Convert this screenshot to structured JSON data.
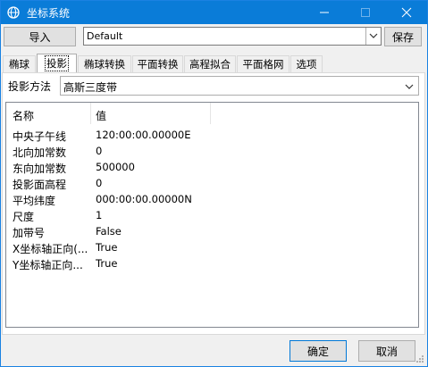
{
  "window": {
    "title": "坐标系统",
    "minimize_icon": "minimize-icon",
    "maximize_icon": "maximize-icon",
    "close_icon": "close-icon",
    "title_bar_color": "#0a7cd8"
  },
  "toolbar": {
    "import_label": "导入",
    "profile_value": "Default",
    "save_label": "保存"
  },
  "tabs": [
    {
      "label": "椭球",
      "active": false
    },
    {
      "label": "投影",
      "active": true
    },
    {
      "label": "椭球转换",
      "active": false
    },
    {
      "label": "平面转换",
      "active": false
    },
    {
      "label": "高程拟合",
      "active": false
    },
    {
      "label": "平面格网",
      "active": false
    },
    {
      "label": "选项",
      "active": false
    }
  ],
  "projection": {
    "method_label": "投影方法",
    "method_value": "高斯三度带"
  },
  "grid": {
    "headers": {
      "name": "名称",
      "value": "值"
    },
    "rows": [
      {
        "name": "中央子午线",
        "value": "120:00:00.00000E"
      },
      {
        "name": "北向加常数",
        "value": "0"
      },
      {
        "name": "东向加常数",
        "value": "500000"
      },
      {
        "name": "投影面高程",
        "value": "0"
      },
      {
        "name": "平均纬度",
        "value": "000:00:00.00000N"
      },
      {
        "name": "尺度",
        "value": "1"
      },
      {
        "name": "加带号",
        "value": "False"
      },
      {
        "name": "X坐标轴正向(...",
        "value": "True"
      },
      {
        "name": "Y坐标轴正向...",
        "value": "True"
      }
    ]
  },
  "footer": {
    "ok_label": "确定",
    "cancel_label": "取消"
  }
}
